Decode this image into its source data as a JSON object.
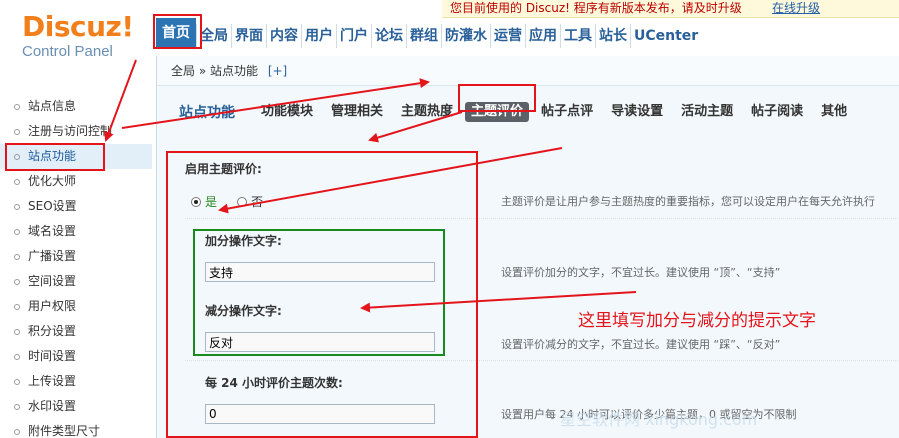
{
  "logo": {
    "brand": "Discuz!",
    "subtitle": "Control Panel"
  },
  "notice": {
    "text": "您目前使用的 Discuz! 程序有新版本发布，请及时升级",
    "link": "在线升级"
  },
  "topnav": [
    "首页",
    "全局",
    "界面",
    "内容",
    "用户",
    "门户",
    "论坛",
    "群组",
    "防灌水",
    "运营",
    "应用",
    "工具",
    "站长",
    "UCenter"
  ],
  "sidebar": [
    "站点信息",
    "注册与访问控制",
    "站点功能",
    "优化大师",
    "SEO设置",
    "域名设置",
    "广播设置",
    "空间设置",
    "用户权限",
    "积分设置",
    "时间设置",
    "上传设置",
    "水印设置",
    "附件类型尺寸"
  ],
  "breadcrumb": {
    "path": "全局 » 站点功能",
    "add": "[+]"
  },
  "section_title": "站点功能",
  "tabs": [
    "功能模块",
    "管理相关",
    "主题热度",
    "主题评价",
    "帖子点评",
    "导读设置",
    "活动主题",
    "帖子阅读",
    "其他"
  ],
  "form": {
    "enable_label": "启用主题评价:",
    "yes": "是",
    "no": "否",
    "enable_tip": "主题评价是让用户参与主题热度的重要指标，您可以设定用户在每天允许执行",
    "plus_label": "加分操作文字:",
    "plus_value": "支持",
    "plus_tip": "设置评价加分的文字，不宜过长。建议使用 “顶”、“支持”",
    "minus_label": "减分操作文字:",
    "minus_value": "反对",
    "minus_tip": "设置评价减分的文字，不宜过长。建议使用 “踩”、“反对”",
    "limit_label": "每 24 小时评价主题次数:",
    "limit_value": "0",
    "limit_tip": "设置用户每 24 小时可以评价多少篇主题，0 或留空为不限制"
  },
  "annotation": "这里填写加分与减分的提示文字",
  "watermark": "星空软件网 xingkong.com",
  "colors": {
    "accent": "#2c74b2",
    "annotation_red": "#e4141b",
    "annotation_green": "#188a1e",
    "logo_orange": "#f07f1c"
  }
}
